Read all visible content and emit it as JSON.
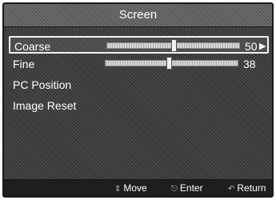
{
  "menu": {
    "title": "Screen",
    "items": [
      {
        "label": "Coarse",
        "value": "50",
        "slider_fraction": 0.5,
        "selected": true
      },
      {
        "label": "Fine",
        "value": "38",
        "slider_fraction": 0.48
      },
      {
        "label": "PC Position"
      },
      {
        "label": "Image Reset"
      }
    ]
  },
  "footer": {
    "move_label": "Move",
    "enter_label": "Enter",
    "return_label": "Return",
    "move_icon": "updown-arrows-icon",
    "enter_icon": "enter-icon",
    "return_icon": "return-icon"
  },
  "colors": {
    "background": "#3c3c3c",
    "text": "#ffffff",
    "footer": "#1e1e1e"
  }
}
